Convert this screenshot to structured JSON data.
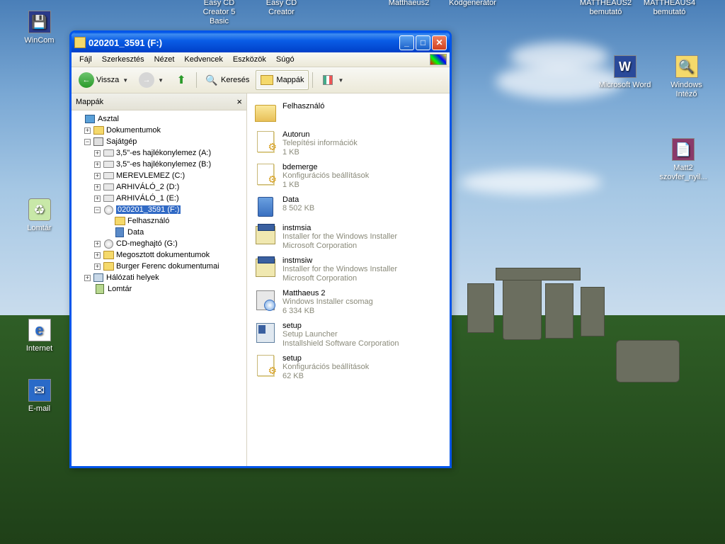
{
  "desktop_icons": {
    "wincom": "WinCom",
    "easycd5": "Easy CD Creator 5 Basic",
    "easycd": "Easy CD Creator",
    "matthaeus2": "Matthaeus2",
    "kodgen": "Kódgenerátor",
    "matth2bem": "MATTHEAUS2 bemutató",
    "matth4bem": "MATTHEAUS4 bemutató",
    "msword": "Microsoft Word",
    "winintezo": "Windows Intéző",
    "matt2szov": "Matt2 szovfer_nyil...",
    "lomtar": "Lomtár",
    "internet": "Internet",
    "email": "E-mail"
  },
  "window": {
    "title": "020201_3591 (F:)"
  },
  "menu": {
    "file": "Fájl",
    "edit": "Szerkesztés",
    "view": "Nézet",
    "favorites": "Kedvencek",
    "tools": "Eszközök",
    "help": "Súgó"
  },
  "toolbar": {
    "back": "Vissza",
    "search": "Keresés",
    "folders": "Mappák"
  },
  "tree": {
    "header": "Mappák",
    "desktop": "Asztal",
    "documents": "Dokumentumok",
    "mycomputer": "Sajátgép",
    "floppyA": "3,5\"-es hajlékonylemez (A:)",
    "floppyB": "3,5\"-es hajlékonylemez (B:)",
    "hddC": "MEREVLEMEZ (C:)",
    "arch2": "ARHIVÁLÓ_2 (D:)",
    "arch1": "ARHIVÁLÓ_1 (E:)",
    "driveF": "020201_3591 (F:)",
    "felhasznalo": "Felhasználó",
    "data": "Data",
    "cdG": "CD-meghajtó (G:)",
    "shared": "Megosztott dokumentumok",
    "burger": "Burger Ferenc dokumentumai",
    "network": "Hálózati helyek",
    "recycle": "Lomtár"
  },
  "files": [
    {
      "name": "Felhasználó",
      "desc": "",
      "size": "",
      "icon": "folder"
    },
    {
      "name": "Autorun",
      "desc": "Telepítési információk",
      "size": "1 KB",
      "icon": "config"
    },
    {
      "name": "bdemerge",
      "desc": "Konfigurációs beállítások",
      "size": "1 KB",
      "icon": "config"
    },
    {
      "name": "Data",
      "desc": "",
      "size": "8 502 KB",
      "icon": "cab"
    },
    {
      "name": "instmsia",
      "desc": "Installer for the Windows Installer",
      "size": "Microsoft Corporation",
      "icon": "installer"
    },
    {
      "name": "instmsiw",
      "desc": "Installer for the Windows Installer",
      "size": "Microsoft Corporation",
      "icon": "installer"
    },
    {
      "name": "Matthaeus 2",
      "desc": "Windows Installer csomag",
      "size": "6 334 KB",
      "icon": "msi"
    },
    {
      "name": "setup",
      "desc": "Setup Launcher",
      "size": "Installshield Software Corporation",
      "icon": "setup"
    },
    {
      "name": "setup",
      "desc": "Konfigurációs beállítások",
      "size": "62 KB",
      "icon": "config"
    }
  ]
}
